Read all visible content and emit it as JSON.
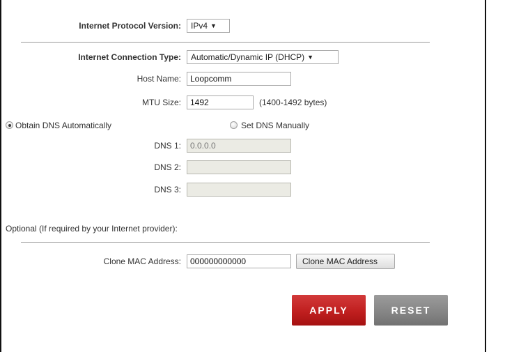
{
  "protocol": {
    "label": "Internet Protocol Version:",
    "value": "IPv4",
    "arrow_icon": "triangle-down"
  },
  "connection": {
    "type_label": "Internet Connection Type:",
    "type_value": "Automatic/Dynamic IP (DHCP)",
    "host_label": "Host Name:",
    "host_value": "Loopcomm",
    "mtu_label": "MTU Size:",
    "mtu_value": "1492",
    "mtu_hint": "(1400-1492 bytes)"
  },
  "dns": {
    "auto_label": "Obtain DNS Automatically",
    "auto_selected": true,
    "manual_label": "Set DNS Manually",
    "manual_selected": false,
    "dns1_label": "DNS 1:",
    "dns1_value": "0.0.0.0",
    "dns2_label": "DNS 2:",
    "dns2_value": "",
    "dns3_label": "DNS 3:",
    "dns3_value": ""
  },
  "optional": {
    "heading": "Optional (If required by your Internet provider):",
    "clone_label": "Clone MAC Address:",
    "clone_value": "000000000000",
    "clone_button": "Clone MAC Address"
  },
  "actions": {
    "apply": "APPLY",
    "reset": "RESET",
    "apply_color": "#c01f1f",
    "reset_color": "#868686"
  }
}
